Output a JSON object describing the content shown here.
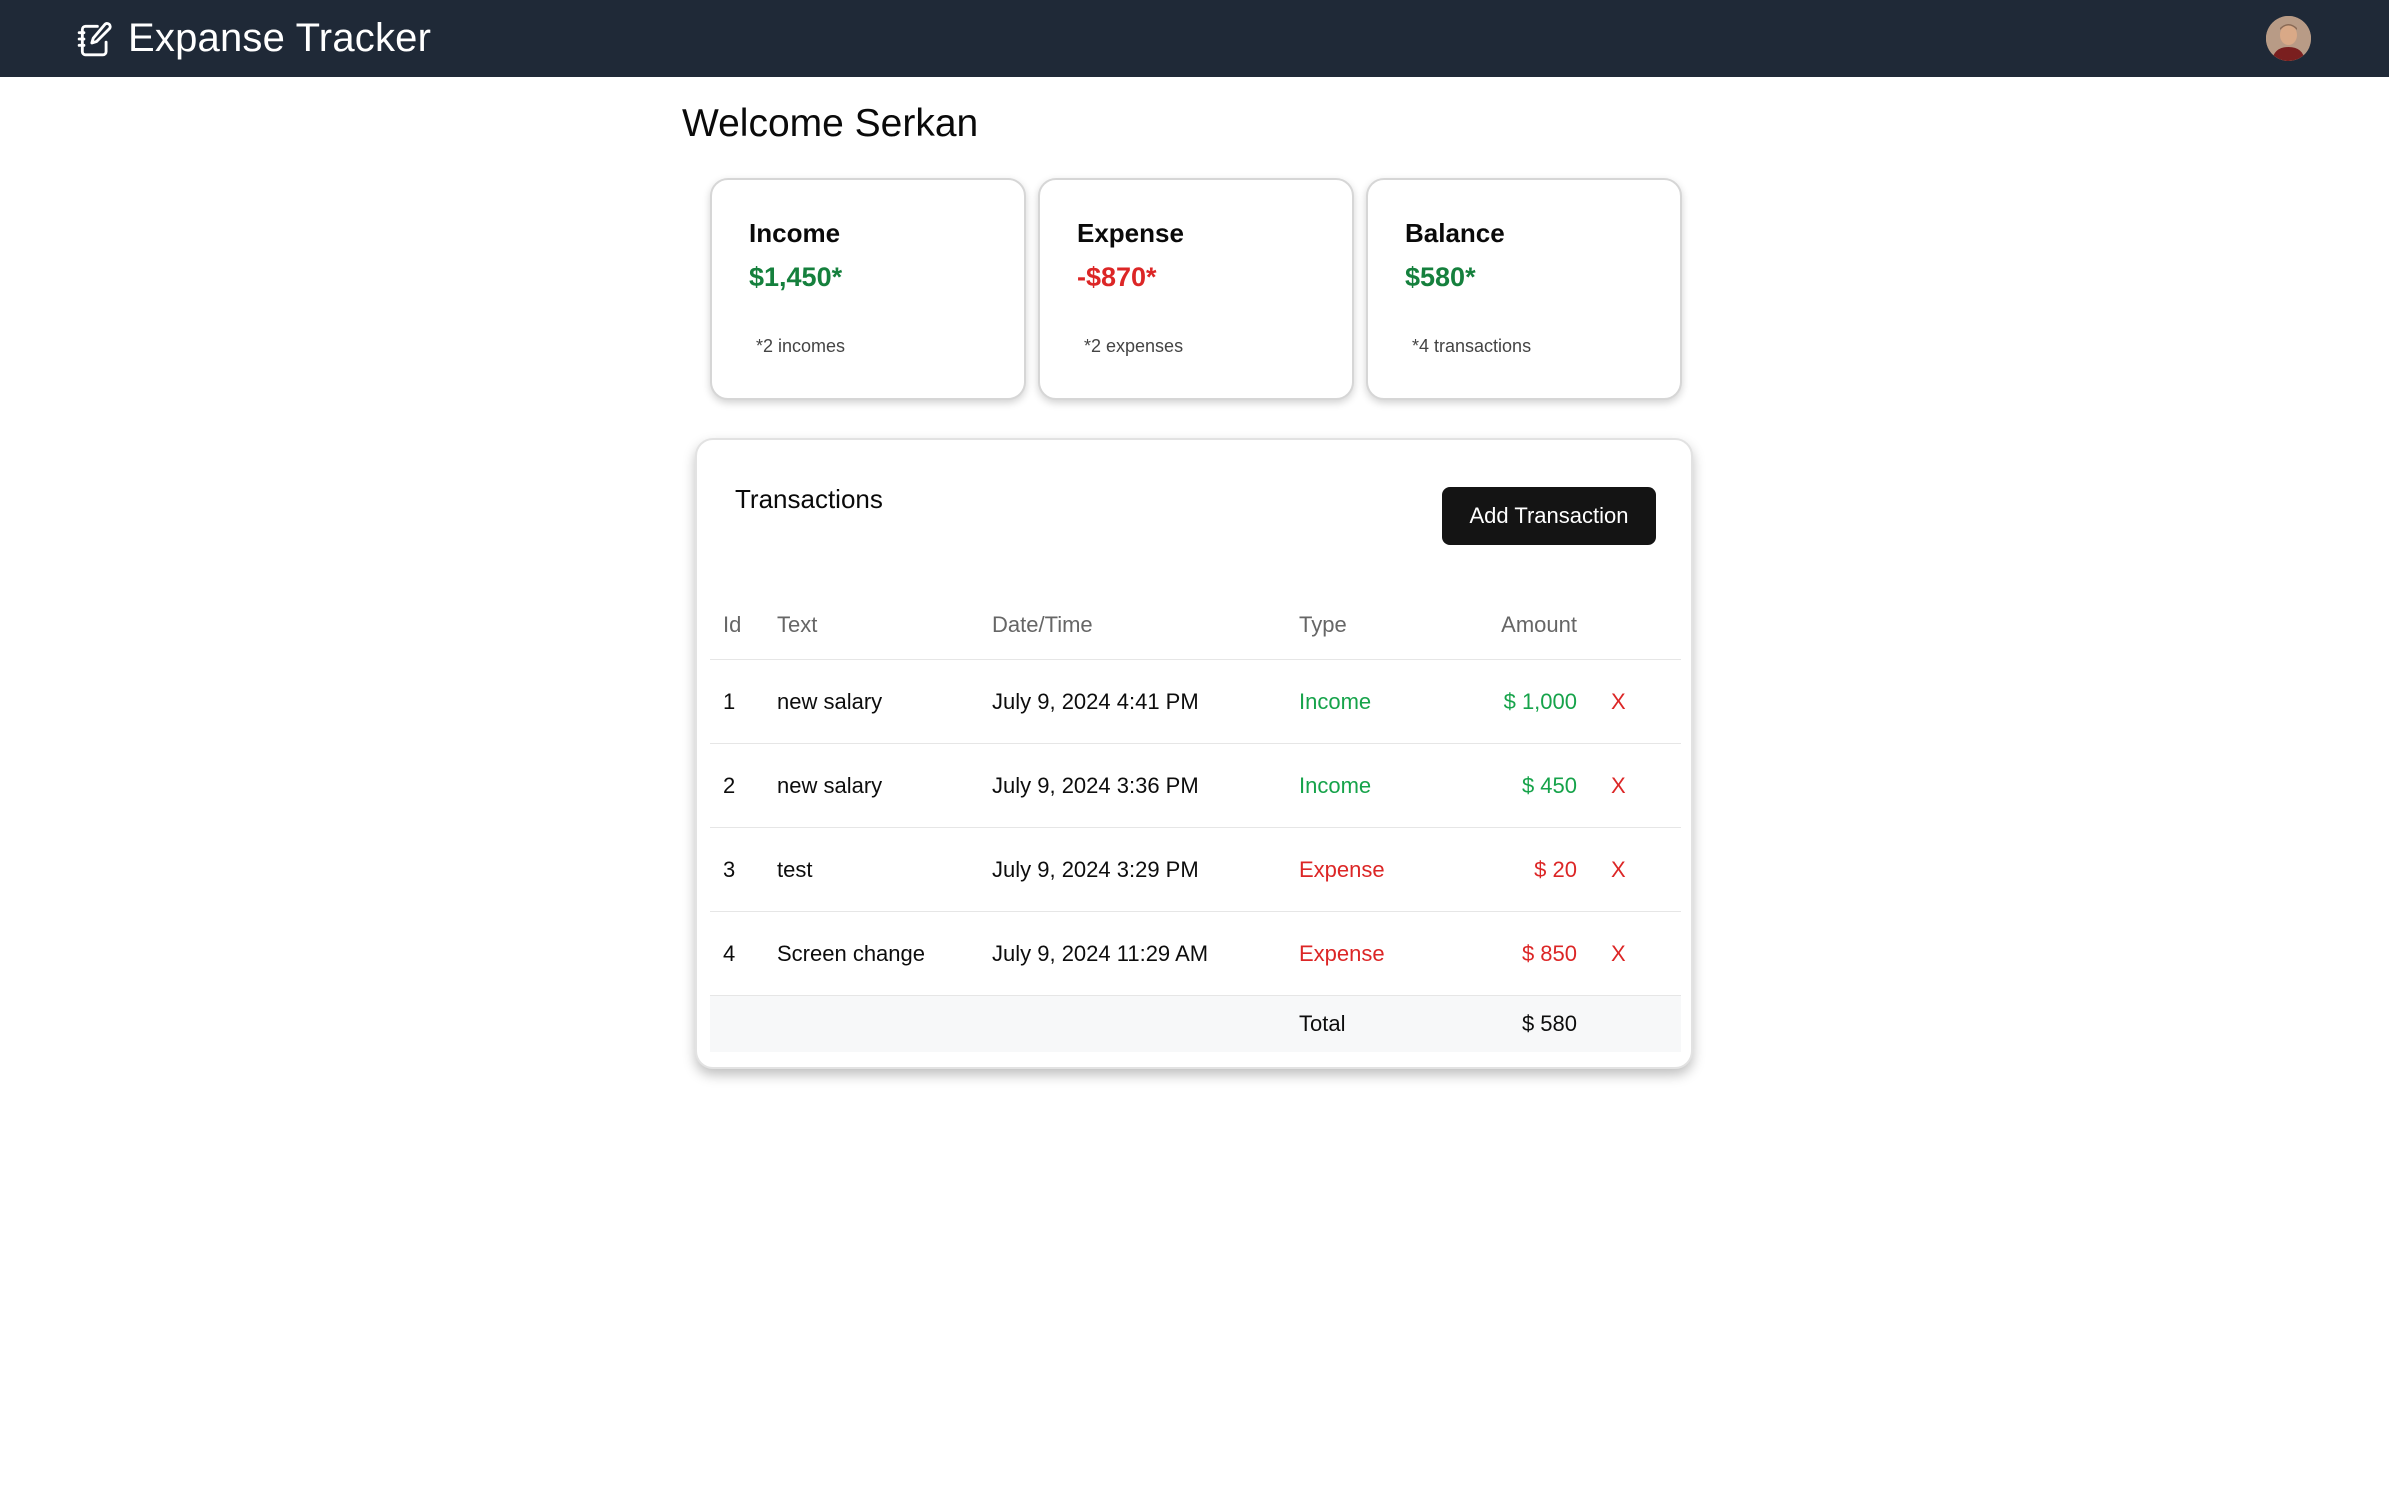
{
  "app": {
    "title": "Expanse Tracker",
    "icon": "notebook-edit-icon"
  },
  "header": {
    "avatar": "user-avatar"
  },
  "welcome": "Welcome Serkan",
  "summary": {
    "income": {
      "title": "Income",
      "value": "$1,450*",
      "note": "*2 incomes",
      "color": "#15803d"
    },
    "expense": {
      "title": "Expense",
      "value": "-$870*",
      "note": "*2 expenses",
      "color": "#dc2626"
    },
    "balance": {
      "title": "Balance",
      "value": "$580*",
      "note": "*4 transactions",
      "color": "#15803d"
    }
  },
  "transactions": {
    "title": "Transactions",
    "add_label": "Add Transaction",
    "columns": {
      "id": "Id",
      "text": "Text",
      "date": "Date/Time",
      "type": "Type",
      "amount": "Amount"
    },
    "rows": [
      {
        "id": "1",
        "text": "new salary",
        "date": "July 9, 2024 4:41 PM",
        "type": "Income",
        "amount": "$ 1,000",
        "delete": "X"
      },
      {
        "id": "2",
        "text": "new salary",
        "date": "July 9, 2024 3:36 PM",
        "type": "Income",
        "amount": "$ 450",
        "delete": "X"
      },
      {
        "id": "3",
        "text": "test",
        "date": "July 9, 2024 3:29 PM",
        "type": "Expense",
        "amount": "$ 20",
        "delete": "X"
      },
      {
        "id": "4",
        "text": "Screen change",
        "date": "July 9, 2024 11:29 AM",
        "type": "Expense",
        "amount": "$ 850",
        "delete": "X"
      }
    ],
    "total_label": "Total",
    "total_value": "$ 580"
  },
  "colors": {
    "header_bg": "#1f2937",
    "income": "#16a34a",
    "expense": "#dc2626",
    "button_bg": "#141414"
  }
}
